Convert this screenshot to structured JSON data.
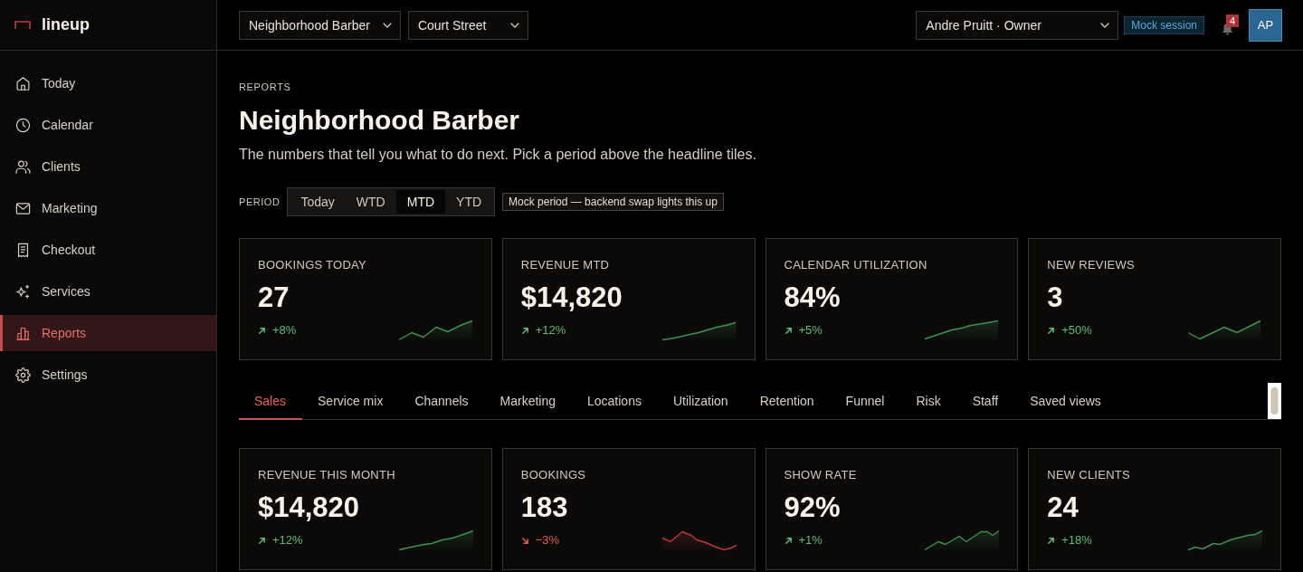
{
  "sidebar": {
    "logo": "lineup",
    "items": [
      {
        "label": "Today",
        "selected": false
      },
      {
        "label": "Calendar",
        "selected": false
      },
      {
        "label": "Clients",
        "selected": false
      },
      {
        "label": "Marketing",
        "selected": false
      },
      {
        "label": "Checkout",
        "selected": false
      },
      {
        "label": "Services",
        "selected": false
      },
      {
        "label": "Reports",
        "selected": true
      },
      {
        "label": "Settings",
        "selected": false
      }
    ]
  },
  "topbar": {
    "business": "Neighborhood Barber",
    "location": "Court Street",
    "user": "Andre Pruitt · Owner",
    "session_badge": "Mock session",
    "notification_count": "4",
    "avatar": "AP"
  },
  "header": {
    "eyebrow": "REPORTS",
    "title": "Neighborhood Barber",
    "subtitle": "The numbers that tell you what to do next. Pick a period above the headline tiles."
  },
  "period": {
    "label": "PERIOD",
    "options": [
      {
        "label": "Today",
        "selected": false
      },
      {
        "label": "WTD",
        "selected": false
      },
      {
        "label": "MTD",
        "selected": true
      },
      {
        "label": "YTD",
        "selected": false
      }
    ],
    "note": "Mock period — backend swap lights this up"
  },
  "kpis": [
    {
      "label": "BOOKINGS TODAY",
      "value": "27",
      "delta": "+8%",
      "positive": true
    },
    {
      "label": "REVENUE MTD",
      "value": "$14,820",
      "delta": "+12%",
      "positive": true
    },
    {
      "label": "CALENDAR UTILIZATION",
      "value": "84%",
      "delta": "+5%",
      "positive": true
    },
    {
      "label": "NEW REVIEWS",
      "value": "3",
      "delta": "+50%",
      "positive": true
    }
  ],
  "tabs": [
    {
      "label": "Sales",
      "selected": true
    },
    {
      "label": "Service mix",
      "selected": false
    },
    {
      "label": "Channels",
      "selected": false
    },
    {
      "label": "Marketing",
      "selected": false
    },
    {
      "label": "Locations",
      "selected": false
    },
    {
      "label": "Utilization",
      "selected": false
    },
    {
      "label": "Retention",
      "selected": false
    },
    {
      "label": "Funnel",
      "selected": false
    },
    {
      "label": "Risk",
      "selected": false
    },
    {
      "label": "Staff",
      "selected": false
    },
    {
      "label": "Saved views",
      "selected": false
    }
  ],
  "sales_metrics": [
    {
      "label": "REVENUE THIS MONTH",
      "value": "$14,820",
      "delta": "+12%",
      "positive": true
    },
    {
      "label": "BOOKINGS",
      "value": "183",
      "delta": "−3%",
      "positive": false
    },
    {
      "label": "SHOW RATE",
      "value": "92%",
      "delta": "+1%",
      "positive": true
    },
    {
      "label": "NEW CLIENTS",
      "value": "24",
      "delta": "+18%",
      "positive": true
    }
  ]
}
